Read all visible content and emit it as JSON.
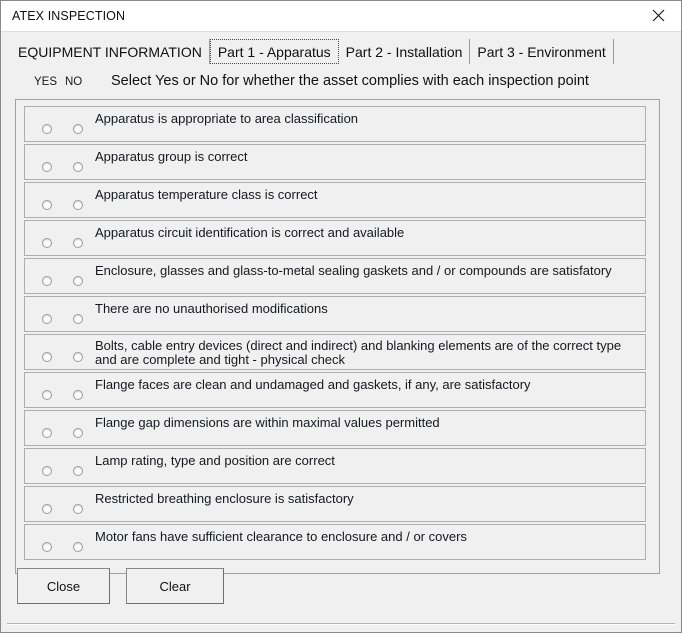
{
  "window": {
    "title": "ATEX INSPECTION",
    "close_icon": "close-icon"
  },
  "tabs": [
    {
      "label": "EQUIPMENT INFORMATION",
      "selected": false
    },
    {
      "label": "Part 1 - Apparatus",
      "selected": true
    },
    {
      "label": "Part 2 - Installation",
      "selected": false
    },
    {
      "label": "Part 3 - Environment",
      "selected": false
    }
  ],
  "header": {
    "yes_label": "YES",
    "no_label": "NO",
    "instruction": "Select Yes or No for whether the asset complies with each inspection point"
  },
  "inspection_points": [
    {
      "label": "Apparatus is appropriate to area classification"
    },
    {
      "label": "Apparatus group is correct"
    },
    {
      "label": "Apparatus temperature class is correct"
    },
    {
      "label": "Apparatus circuit identification is correct and available"
    },
    {
      "label": "Enclosure, glasses and glass-to-metal sealing gaskets and / or compounds are satisfatory"
    },
    {
      "label": "There are no unauthorised modifications"
    },
    {
      "label": "Bolts, cable entry devices (direct and indirect) and blanking elements are of the correct type and are complete and tight - physical check"
    },
    {
      "label": "Flange faces are clean and undamaged and gaskets, if any, are satisfactory"
    },
    {
      "label": "Flange gap dimensions are within maximal values permitted"
    },
    {
      "label": "Lamp rating, type and position are correct"
    },
    {
      "label": "Restricted breathing enclosure is satisfactory"
    },
    {
      "label": "Motor fans have sufficient clearance to enclosure and / or covers"
    }
  ],
  "buttons": {
    "close": "Close",
    "clear": "Clear"
  },
  "colors": {
    "window_background": "#f0f0f0",
    "titlebar_background": "#ffffff",
    "border": "#a0a0a0",
    "text": "#111111"
  }
}
